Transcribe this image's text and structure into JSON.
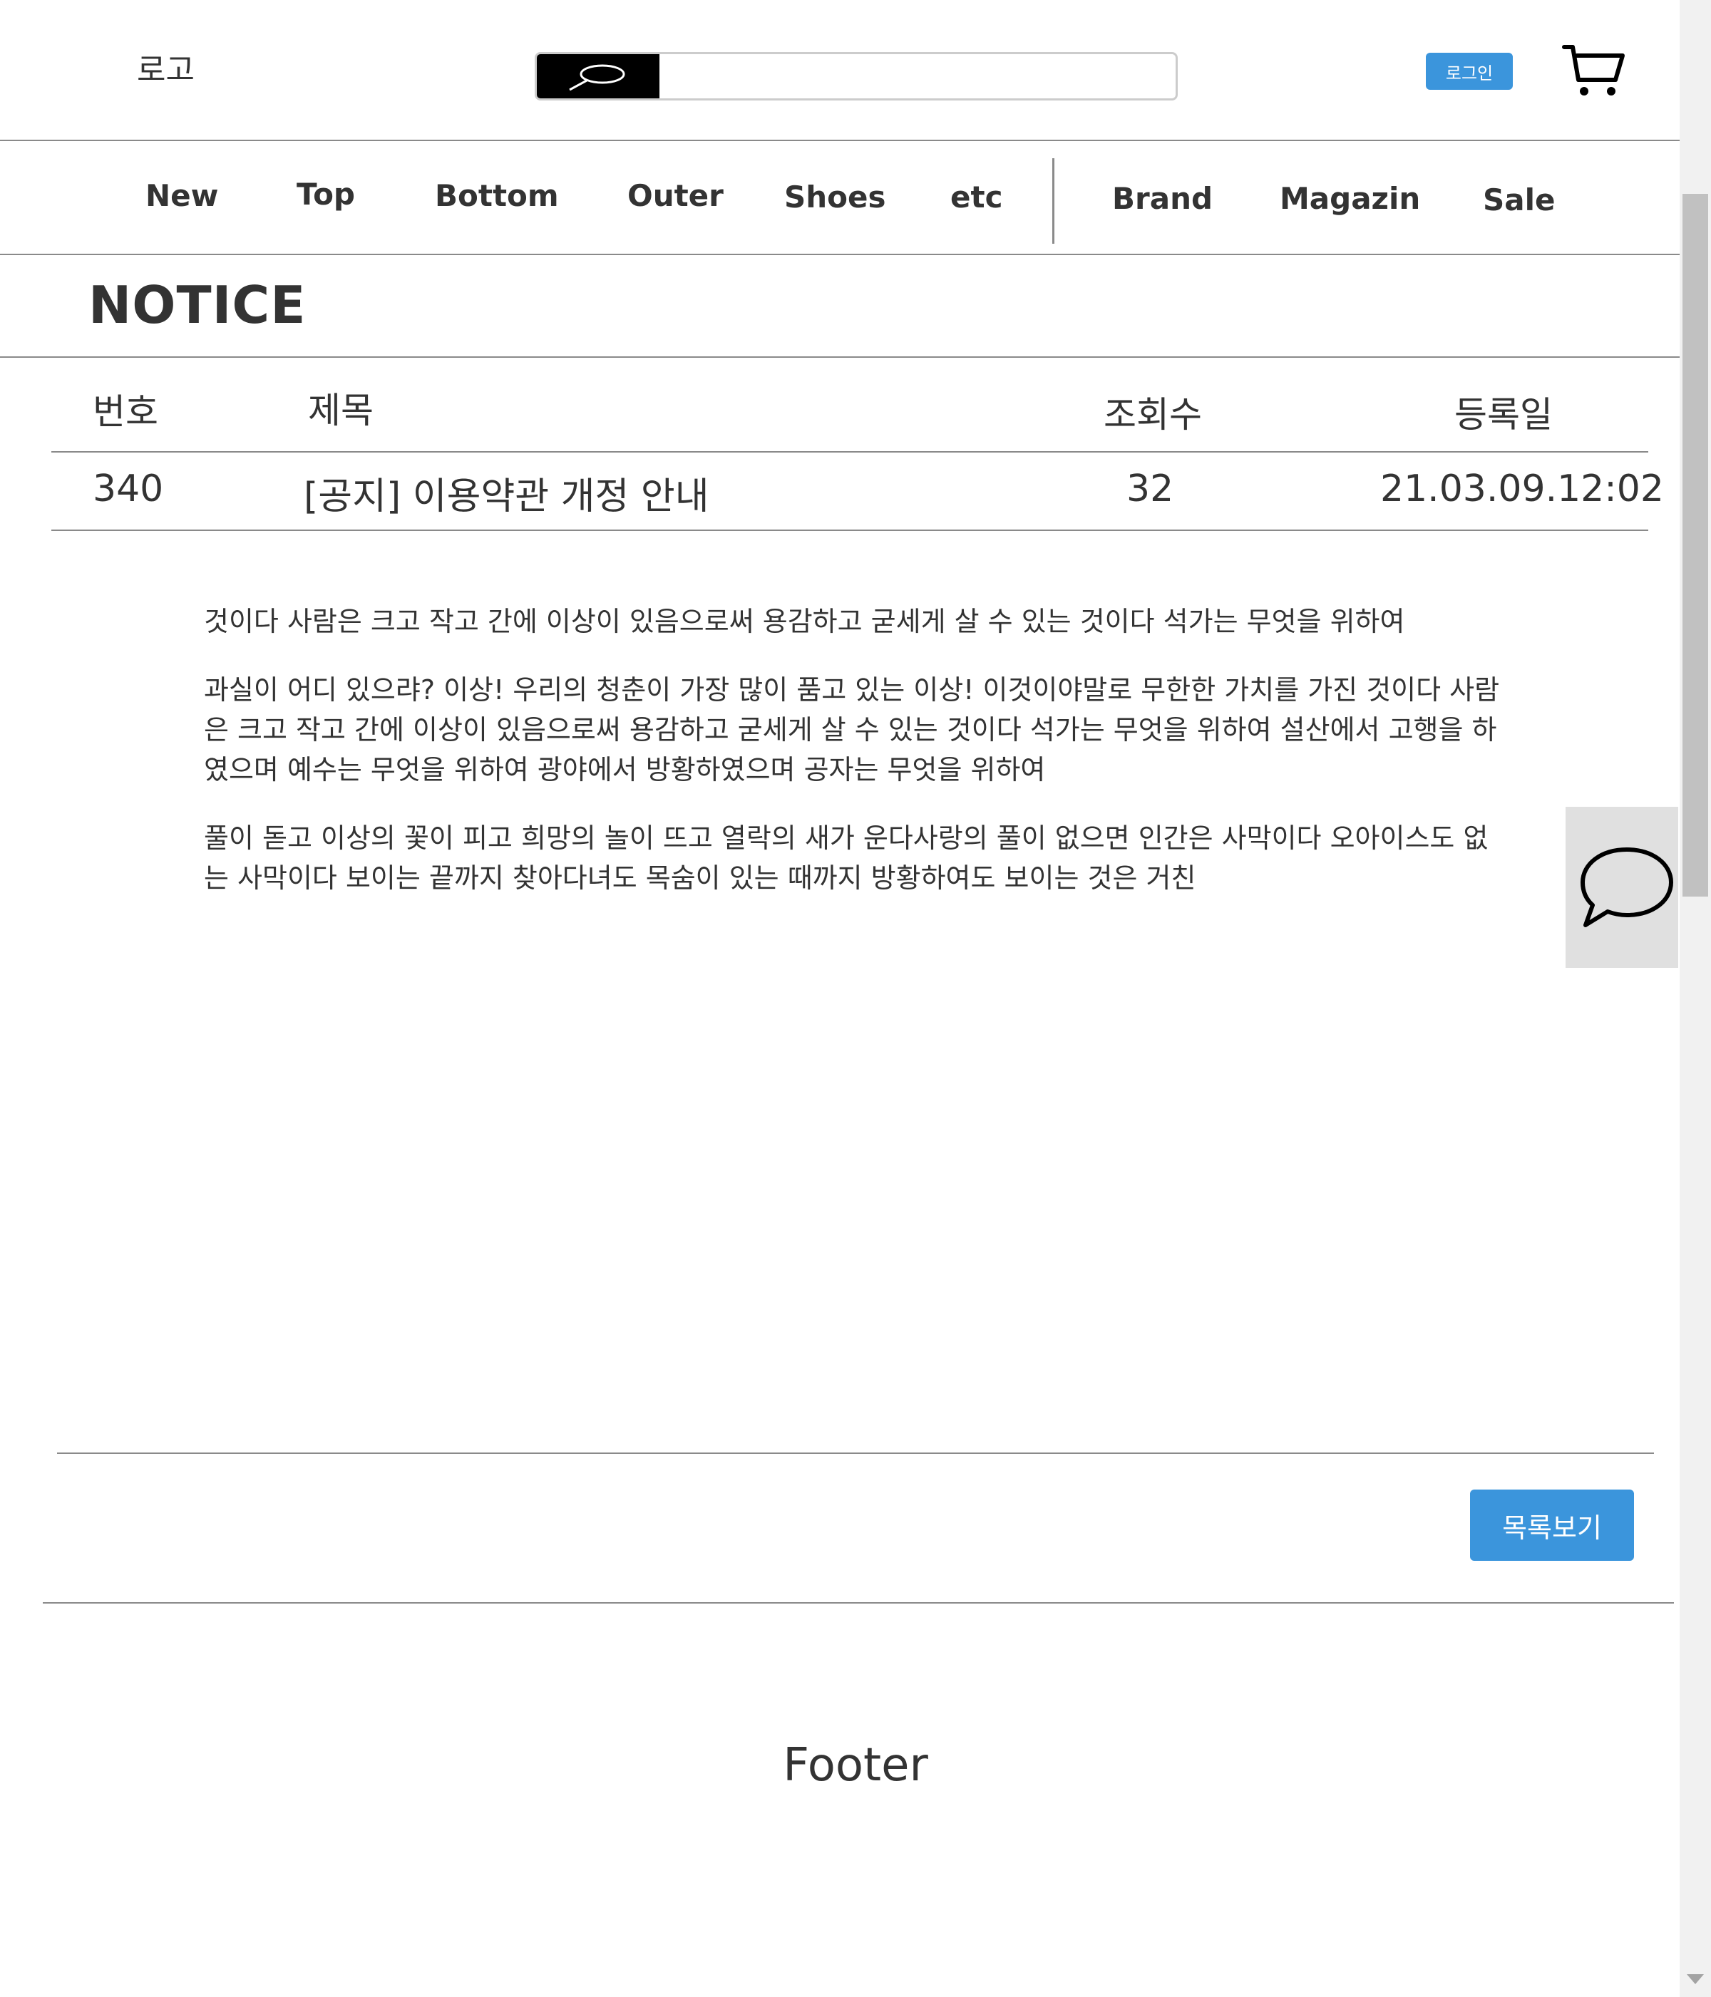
{
  "header": {
    "logo": "로고",
    "search": {
      "placeholder": "",
      "value": "",
      "icon": "search-icon"
    },
    "login_label": "로그인",
    "cart_icon": "cart-icon"
  },
  "nav": {
    "items": [
      {
        "label": "New"
      },
      {
        "label": "Top"
      },
      {
        "label": "Bottom"
      },
      {
        "label": "Outer"
      },
      {
        "label": "Shoes"
      },
      {
        "label": "etc"
      },
      {
        "label": "Brand"
      },
      {
        "label": "Magazin"
      },
      {
        "label": "Sale"
      }
    ]
  },
  "notice": {
    "title": "NOTICE",
    "columns": [
      "번호",
      "제목",
      "조회수",
      "등록일"
    ],
    "row": {
      "number": "340",
      "subject": "[공지] 이용약관 개정 안내",
      "views": "32",
      "date": "21.03.09.12:02"
    },
    "paragraphs": [
      "것이다 사람은 크고 작고 간에 이상이 있음으로써 용감하고 굳세게 살 수 있는 것이다 석가는 무엇을 위하여",
      "과실이 어디 있으랴? 이상! 우리의 청춘이 가장 많이 품고 있는 이상! 이것이야말로 무한한 가치를 가진 것이다 사람은 크고 작고 간에 이상이 있음으로써 용감하고 굳세게 살 수 있는 것이다 석가는 무엇을 위하여 설산에서 고행을 하였으며 예수는 무엇을 위하여 광야에서 방황하였으며 공자는 무엇을 위하여",
      "풀이 돋고 이상의 꽃이 피고 희망의 놀이 뜨고 열락의 새가 운다사랑의 풀이 없으면 인간은 사막이다 오아이스도 없는 사막이다 보이는 끝까지 찾아다녀도 목숨이 있는 때까지 방황하여도 보이는 것은 거친"
    ],
    "list_button": "목록보기"
  },
  "footer": {
    "label": "Footer"
  },
  "chat": {
    "icon": "chat-icon"
  },
  "colors": {
    "accent": "#3b95dc",
    "text": "#333333",
    "divider": "#8a8a8a",
    "chat_bg": "#e0e0e0"
  }
}
